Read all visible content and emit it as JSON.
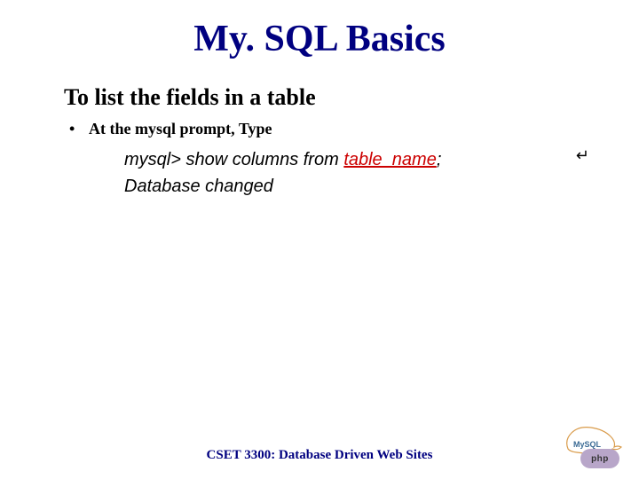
{
  "title": "My. SQL Basics",
  "subtitle": "To list the fields in a table",
  "bullet": "At the mysql prompt, Type",
  "code": {
    "prompt": "mysql> ",
    "cmd_pre": "show columns from ",
    "table_name": "table_name",
    "cmd_post": ";",
    "response": "Database changed"
  },
  "return_symbol": "↵",
  "footer": "CSET 3300: Database Driven Web Sites",
  "logos": {
    "mysql_label": "MySQL",
    "php_label": "php"
  }
}
